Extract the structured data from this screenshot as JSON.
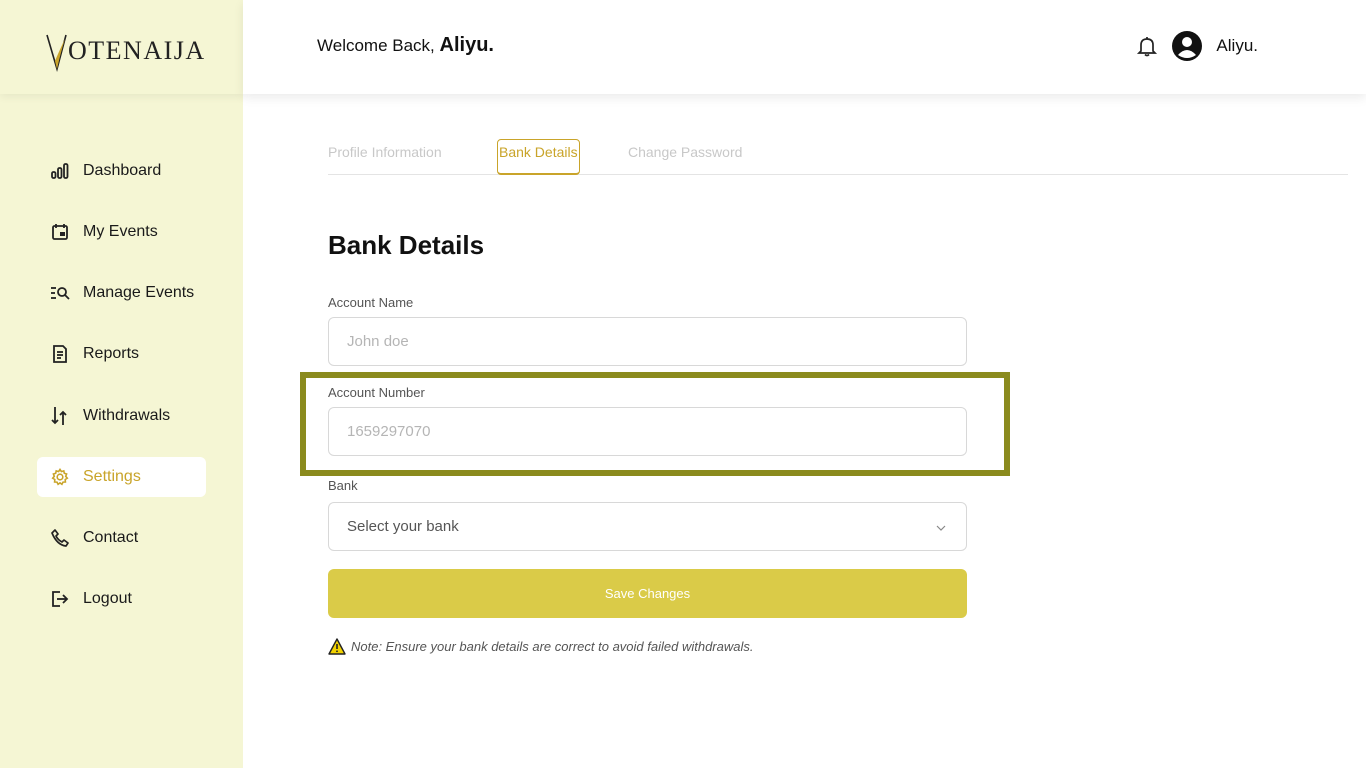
{
  "brand": {
    "logo_initial": "V",
    "logo_rest": "OTENAIJA"
  },
  "header": {
    "welcome_prefix": "Welcome Back,",
    "welcome_name": "Aliyu.",
    "user_name": "Aliyu."
  },
  "sidebar": {
    "items": [
      {
        "label": "Dashboard",
        "icon": "bar-chart-icon"
      },
      {
        "label": "My Events",
        "icon": "calendar-icon"
      },
      {
        "label": "Manage Events",
        "icon": "search-list-icon"
      },
      {
        "label": "Reports",
        "icon": "document-icon"
      },
      {
        "label": "Withdrawals",
        "icon": "transfer-icon"
      },
      {
        "label": "Settings",
        "icon": "gear-icon"
      },
      {
        "label": "Contact",
        "icon": "phone-icon"
      },
      {
        "label": "Logout",
        "icon": "logout-icon"
      }
    ],
    "active_index": 5
  },
  "tabs": [
    "Profile Information",
    "Bank Details",
    "Change Password"
  ],
  "active_tab": 1,
  "form": {
    "title": "Bank Details",
    "account_name_label": "Account Name",
    "account_name_placeholder": "John doe",
    "account_number_label": "Account Number",
    "account_number_placeholder": "1659297070",
    "bank_label": "Bank",
    "bank_value": "Select your bank",
    "save_label": "Save Changes",
    "note": "Note: Ensure your bank details are correct to avoid failed withdrawals."
  },
  "colors": {
    "accent": "#c9a42a",
    "sidebar_bg": "#f5f6d4",
    "button_bg": "#dacb48",
    "highlight": "#8b8b1e"
  }
}
